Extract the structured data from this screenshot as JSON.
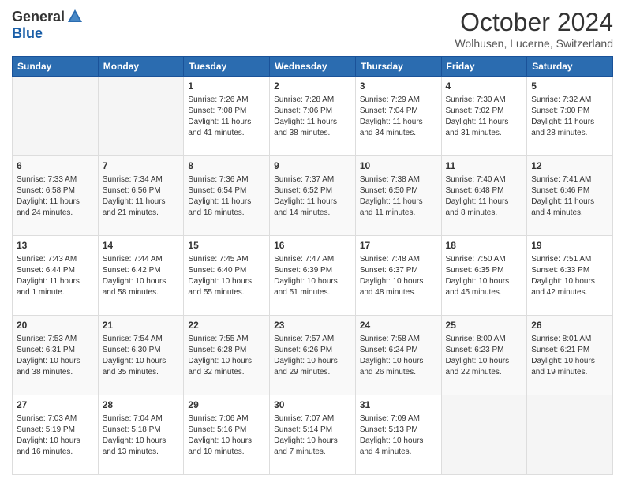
{
  "header": {
    "logo": {
      "general": "General",
      "blue": "Blue"
    },
    "title": "October 2024",
    "location": "Wolhusen, Lucerne, Switzerland"
  },
  "days_of_week": [
    "Sunday",
    "Monday",
    "Tuesday",
    "Wednesday",
    "Thursday",
    "Friday",
    "Saturday"
  ],
  "weeks": [
    [
      {
        "day": "",
        "sunrise": "",
        "sunset": "",
        "daylight": ""
      },
      {
        "day": "",
        "sunrise": "",
        "sunset": "",
        "daylight": ""
      },
      {
        "day": "1",
        "sunrise": "Sunrise: 7:26 AM",
        "sunset": "Sunset: 7:08 PM",
        "daylight": "Daylight: 11 hours and 41 minutes."
      },
      {
        "day": "2",
        "sunrise": "Sunrise: 7:28 AM",
        "sunset": "Sunset: 7:06 PM",
        "daylight": "Daylight: 11 hours and 38 minutes."
      },
      {
        "day": "3",
        "sunrise": "Sunrise: 7:29 AM",
        "sunset": "Sunset: 7:04 PM",
        "daylight": "Daylight: 11 hours and 34 minutes."
      },
      {
        "day": "4",
        "sunrise": "Sunrise: 7:30 AM",
        "sunset": "Sunset: 7:02 PM",
        "daylight": "Daylight: 11 hours and 31 minutes."
      },
      {
        "day": "5",
        "sunrise": "Sunrise: 7:32 AM",
        "sunset": "Sunset: 7:00 PM",
        "daylight": "Daylight: 11 hours and 28 minutes."
      }
    ],
    [
      {
        "day": "6",
        "sunrise": "Sunrise: 7:33 AM",
        "sunset": "Sunset: 6:58 PM",
        "daylight": "Daylight: 11 hours and 24 minutes."
      },
      {
        "day": "7",
        "sunrise": "Sunrise: 7:34 AM",
        "sunset": "Sunset: 6:56 PM",
        "daylight": "Daylight: 11 hours and 21 minutes."
      },
      {
        "day": "8",
        "sunrise": "Sunrise: 7:36 AM",
        "sunset": "Sunset: 6:54 PM",
        "daylight": "Daylight: 11 hours and 18 minutes."
      },
      {
        "day": "9",
        "sunrise": "Sunrise: 7:37 AM",
        "sunset": "Sunset: 6:52 PM",
        "daylight": "Daylight: 11 hours and 14 minutes."
      },
      {
        "day": "10",
        "sunrise": "Sunrise: 7:38 AM",
        "sunset": "Sunset: 6:50 PM",
        "daylight": "Daylight: 11 hours and 11 minutes."
      },
      {
        "day": "11",
        "sunrise": "Sunrise: 7:40 AM",
        "sunset": "Sunset: 6:48 PM",
        "daylight": "Daylight: 11 hours and 8 minutes."
      },
      {
        "day": "12",
        "sunrise": "Sunrise: 7:41 AM",
        "sunset": "Sunset: 6:46 PM",
        "daylight": "Daylight: 11 hours and 4 minutes."
      }
    ],
    [
      {
        "day": "13",
        "sunrise": "Sunrise: 7:43 AM",
        "sunset": "Sunset: 6:44 PM",
        "daylight": "Daylight: 11 hours and 1 minute."
      },
      {
        "day": "14",
        "sunrise": "Sunrise: 7:44 AM",
        "sunset": "Sunset: 6:42 PM",
        "daylight": "Daylight: 10 hours and 58 minutes."
      },
      {
        "day": "15",
        "sunrise": "Sunrise: 7:45 AM",
        "sunset": "Sunset: 6:40 PM",
        "daylight": "Daylight: 10 hours and 55 minutes."
      },
      {
        "day": "16",
        "sunrise": "Sunrise: 7:47 AM",
        "sunset": "Sunset: 6:39 PM",
        "daylight": "Daylight: 10 hours and 51 minutes."
      },
      {
        "day": "17",
        "sunrise": "Sunrise: 7:48 AM",
        "sunset": "Sunset: 6:37 PM",
        "daylight": "Daylight: 10 hours and 48 minutes."
      },
      {
        "day": "18",
        "sunrise": "Sunrise: 7:50 AM",
        "sunset": "Sunset: 6:35 PM",
        "daylight": "Daylight: 10 hours and 45 minutes."
      },
      {
        "day": "19",
        "sunrise": "Sunrise: 7:51 AM",
        "sunset": "Sunset: 6:33 PM",
        "daylight": "Daylight: 10 hours and 42 minutes."
      }
    ],
    [
      {
        "day": "20",
        "sunrise": "Sunrise: 7:53 AM",
        "sunset": "Sunset: 6:31 PM",
        "daylight": "Daylight: 10 hours and 38 minutes."
      },
      {
        "day": "21",
        "sunrise": "Sunrise: 7:54 AM",
        "sunset": "Sunset: 6:30 PM",
        "daylight": "Daylight: 10 hours and 35 minutes."
      },
      {
        "day": "22",
        "sunrise": "Sunrise: 7:55 AM",
        "sunset": "Sunset: 6:28 PM",
        "daylight": "Daylight: 10 hours and 32 minutes."
      },
      {
        "day": "23",
        "sunrise": "Sunrise: 7:57 AM",
        "sunset": "Sunset: 6:26 PM",
        "daylight": "Daylight: 10 hours and 29 minutes."
      },
      {
        "day": "24",
        "sunrise": "Sunrise: 7:58 AM",
        "sunset": "Sunset: 6:24 PM",
        "daylight": "Daylight: 10 hours and 26 minutes."
      },
      {
        "day": "25",
        "sunrise": "Sunrise: 8:00 AM",
        "sunset": "Sunset: 6:23 PM",
        "daylight": "Daylight: 10 hours and 22 minutes."
      },
      {
        "day": "26",
        "sunrise": "Sunrise: 8:01 AM",
        "sunset": "Sunset: 6:21 PM",
        "daylight": "Daylight: 10 hours and 19 minutes."
      }
    ],
    [
      {
        "day": "27",
        "sunrise": "Sunrise: 7:03 AM",
        "sunset": "Sunset: 5:19 PM",
        "daylight": "Daylight: 10 hours and 16 minutes."
      },
      {
        "day": "28",
        "sunrise": "Sunrise: 7:04 AM",
        "sunset": "Sunset: 5:18 PM",
        "daylight": "Daylight: 10 hours and 13 minutes."
      },
      {
        "day": "29",
        "sunrise": "Sunrise: 7:06 AM",
        "sunset": "Sunset: 5:16 PM",
        "daylight": "Daylight: 10 hours and 10 minutes."
      },
      {
        "day": "30",
        "sunrise": "Sunrise: 7:07 AM",
        "sunset": "Sunset: 5:14 PM",
        "daylight": "Daylight: 10 hours and 7 minutes."
      },
      {
        "day": "31",
        "sunrise": "Sunrise: 7:09 AM",
        "sunset": "Sunset: 5:13 PM",
        "daylight": "Daylight: 10 hours and 4 minutes."
      },
      {
        "day": "",
        "sunrise": "",
        "sunset": "",
        "daylight": ""
      },
      {
        "day": "",
        "sunrise": "",
        "sunset": "",
        "daylight": ""
      }
    ]
  ]
}
